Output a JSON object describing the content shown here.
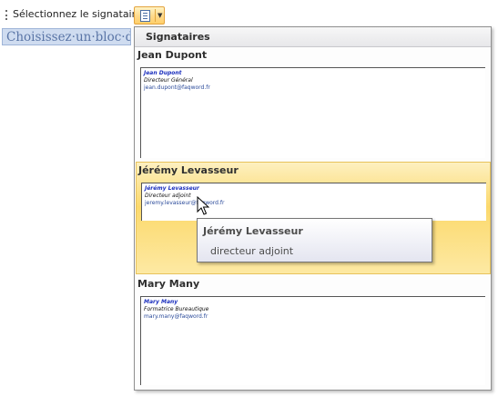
{
  "toolbar": {
    "label": "Sélectionnez le signataire",
    "gallery_button_icon": "signature-gallery-icon",
    "dropdown_icon": "chevron-down-icon"
  },
  "document": {
    "placeholder_text": "Choisissez·un·bloc·de·"
  },
  "panel": {
    "title": "Signataires",
    "signers": [
      {
        "name": "Jean Dupont",
        "sig_name": "Jean Dupont",
        "sig_title": "Directeur Général",
        "sig_email": "jean.dupont@faqword.fr"
      },
      {
        "name": "Jérémy Levasseur",
        "sig_name": "Jérémy Levasseur",
        "sig_title": "Directeur adjoint",
        "sig_email": "jeremy.levasseur@faqword.fr"
      },
      {
        "name": "Mary Many",
        "sig_name": "Mary Many",
        "sig_title": "Formatrice Bureautique",
        "sig_email": "mary.many@faqword.fr"
      }
    ]
  },
  "tooltip": {
    "title": "Jérémy Levasseur",
    "description": "directeur adjoint"
  },
  "colors": {
    "selected_highlight": "#fcd96c",
    "signature_name": "#1a2ebd",
    "document_text": "#5a75a6"
  }
}
